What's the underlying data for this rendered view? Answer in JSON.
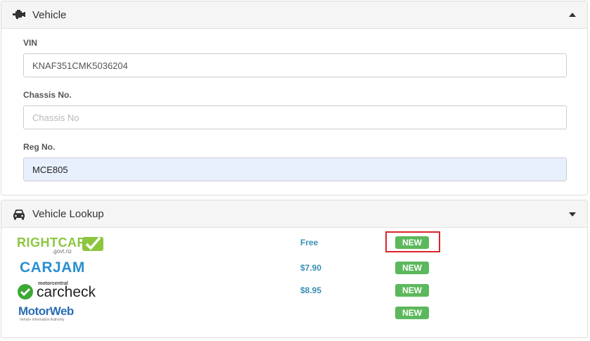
{
  "vehicle": {
    "title": "Vehicle",
    "icon": "engine-icon",
    "fields": {
      "vin": {
        "label": "VIN",
        "value": "KNAF351CMK5036204",
        "placeholder": ""
      },
      "chassis": {
        "label": "Chassis No.",
        "value": "",
        "placeholder": "Chassis No"
      },
      "reg": {
        "label": "Reg No.",
        "value": "MCE805",
        "placeholder": ""
      }
    }
  },
  "lookup": {
    "title": "Vehicle Lookup",
    "icon": "car-icon",
    "services": [
      {
        "name": "RIGHTCAR",
        "sub": ".govt.nz",
        "price": "Free",
        "badge": "NEW"
      },
      {
        "name": "CARJAM",
        "price": "$7.90",
        "badge": "NEW"
      },
      {
        "name": "carcheck",
        "tag": "motorcentral",
        "price": "$8.95",
        "badge": "NEW"
      },
      {
        "name": "MotorWeb",
        "sub": "Vehicle Information Authority",
        "price": "",
        "badge": "NEW"
      }
    ]
  },
  "colors": {
    "price": "#3a8fb7",
    "badge": "#5cb85c",
    "highlight": "#d9262a",
    "autofill": "#e8f0fe"
  }
}
